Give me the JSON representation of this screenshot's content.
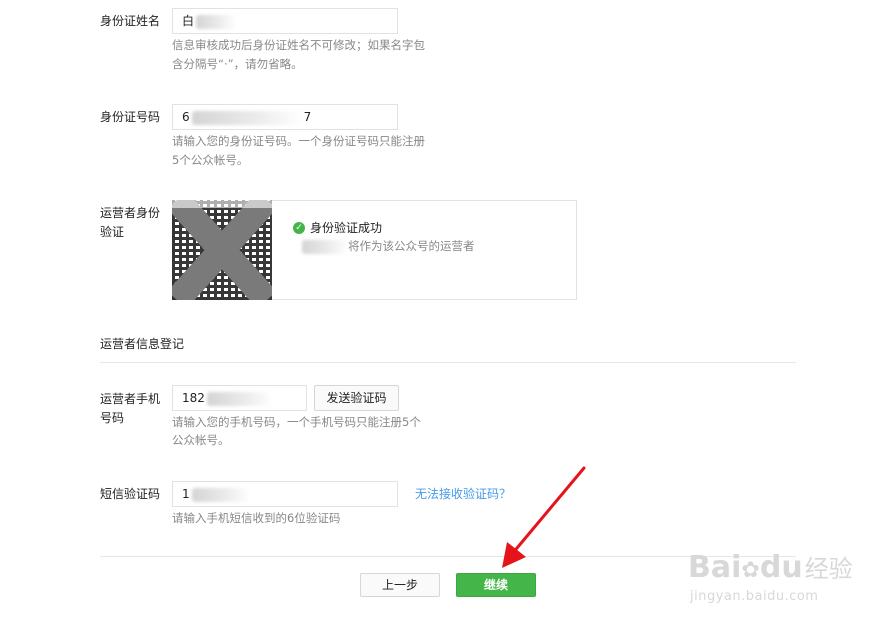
{
  "id_name": {
    "label": "身份证姓名",
    "value": "白",
    "hint_line1": "信息审核成功后身份证姓名不可修改；如果名字包",
    "hint_line2": "含分隔号“·”，请勿省略。"
  },
  "id_number": {
    "label": "身份证号码",
    "value_start": "6",
    "value_end": "7",
    "hint_line1": "请输入您的身份证号码。一个身份证号码只能注册",
    "hint_line2": "5个公众帐号。"
  },
  "operator_verify": {
    "label_line1": "运营者身份",
    "label_line2": "验证",
    "status_title": "身份验证成功",
    "status_desc": "将作为该公众号的运营者",
    "check_glyph": "✓"
  },
  "section": {
    "title": "运营者信息登记"
  },
  "phone": {
    "label_line1": "运营者手机",
    "label_line2": "号码",
    "value": "182",
    "send_button": "发送验证码",
    "hint_line1": "请输入您的手机号码，一个手机号码只能注册5个",
    "hint_line2": "公众帐号。"
  },
  "sms": {
    "label": "短信验证码",
    "value": "1",
    "cannot_receive_link": "无法接收验证码？",
    "hint": "请输入手机短信收到的6位验证码"
  },
  "footer": {
    "prev_button": "上一步",
    "next_button": "继续"
  },
  "watermark": {
    "brand": "Bai",
    "brand_suffix": "du",
    "product": "经验",
    "url": "jingyan.baidu.com"
  },
  "colors": {
    "primary_green": "#44b549",
    "link_blue": "#459ae9",
    "annotation_red": "#e5141a"
  }
}
